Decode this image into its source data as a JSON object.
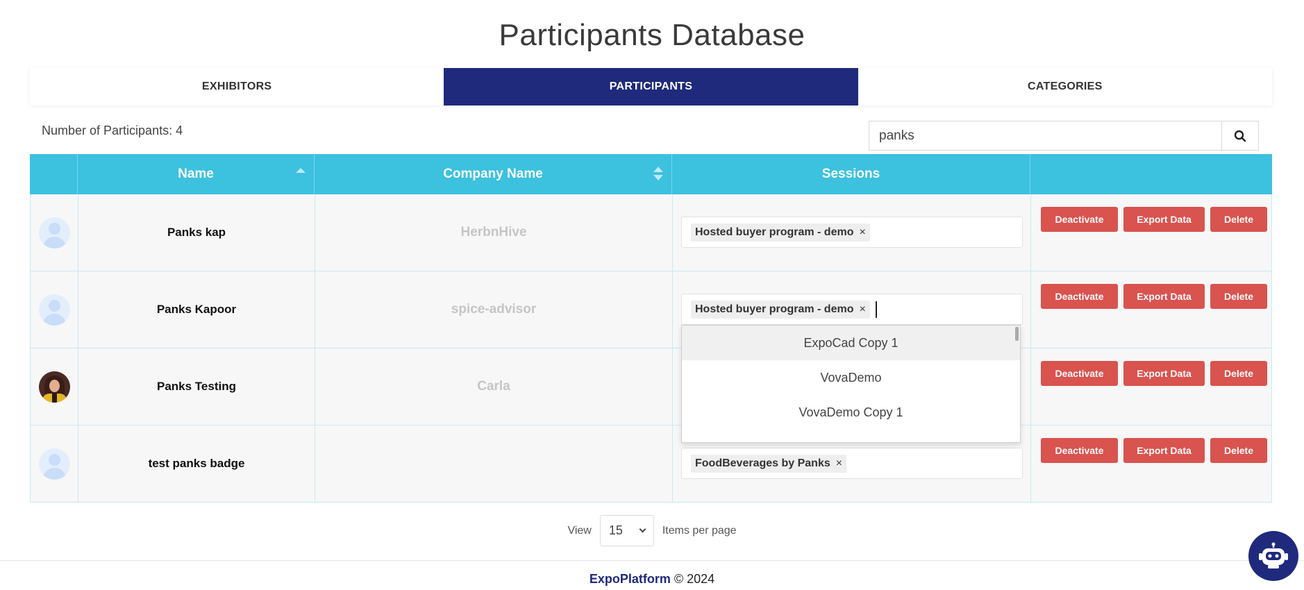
{
  "page": {
    "title": "Participants Database"
  },
  "tabs": [
    {
      "label": "EXHIBITORS",
      "active": false
    },
    {
      "label": "PARTICIPANTS",
      "active": true
    },
    {
      "label": "CATEGORIES",
      "active": false
    }
  ],
  "stats": {
    "count_label": "Number of Participants: 4"
  },
  "search": {
    "value": "panks",
    "icon": "search-icon"
  },
  "table": {
    "headers": [
      "",
      "Name",
      "Company Name",
      "Sessions",
      ""
    ],
    "rows": [
      {
        "avatar": "placeholder",
        "name": "Panks kap",
        "company": "HerbnHive",
        "session": "Hosted buyer program - demo"
      },
      {
        "avatar": "placeholder",
        "name": "Panks Kapoor",
        "company": "spice-advisor",
        "session": "Hosted buyer program - demo"
      },
      {
        "avatar": "photo",
        "name": "Panks Testing",
        "company": "Carla",
        "session": ""
      },
      {
        "avatar": "placeholder",
        "name": "test panks badge",
        "company": "",
        "session": "Food‍Beverages by Panks"
      }
    ],
    "actions": {
      "deactivate": "Deactivate",
      "export": "Export Data",
      "delete": "Delete"
    },
    "chip_remove": "×"
  },
  "dropdown": {
    "options": [
      "ExpoCad Copy 1",
      "VovaDemo",
      "VovaDemo Copy 1"
    ]
  },
  "pagination": {
    "view_label": "View",
    "per_page": "15",
    "items_label": "Items per page"
  },
  "footer": {
    "brand": "ExpoPlatform",
    "copyright": "© 2024"
  },
  "colors": {
    "primary": "#1f2a7c",
    "table_header": "#3cc1df",
    "danger": "#d9534f"
  }
}
